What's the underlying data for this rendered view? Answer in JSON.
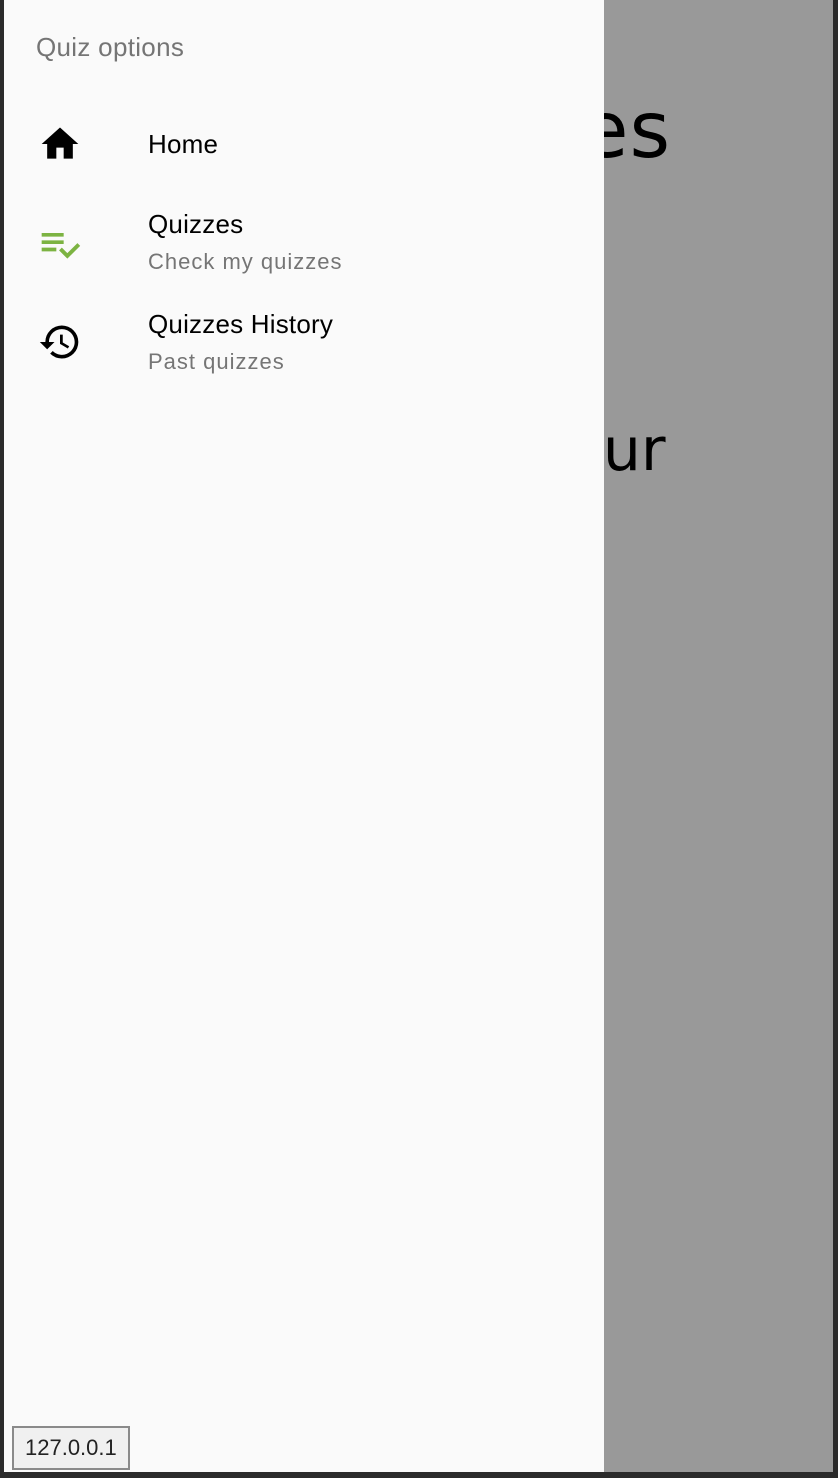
{
  "page": {
    "heading_partial": "izzes",
    "body_partial": "are our"
  },
  "drawer": {
    "header": "Quiz options",
    "items": [
      {
        "label": "Home",
        "subtitle": "",
        "icon": "home-icon",
        "active": false
      },
      {
        "label": "Quizzes",
        "subtitle": "Check my quizzes",
        "icon": "playlist-check-icon",
        "active": true
      },
      {
        "label": "Quizzes History",
        "subtitle": "Past quizzes",
        "icon": "history-icon",
        "active": false
      }
    ]
  },
  "status_bar": {
    "url": "127.0.0.1"
  },
  "colors": {
    "active": "#7cb342",
    "drawer_bg": "#fafafa",
    "secondary_text": "#757575",
    "scrim": "rgba(0,0,0,0.4)"
  }
}
